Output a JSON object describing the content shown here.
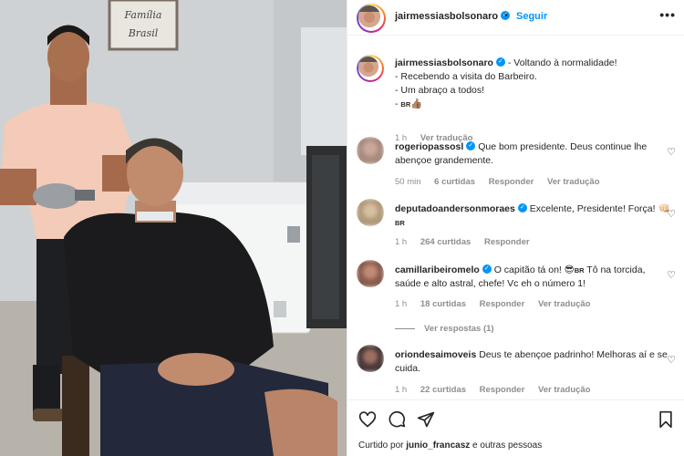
{
  "post_header": {
    "username": "jairmessiasbolsonaro",
    "dot": "•",
    "follow_label": "Seguir",
    "more_label": "•••"
  },
  "photo": {
    "frame_text_line1": "Família",
    "frame_text_line2": "Brasil"
  },
  "caption": {
    "username": "jairmessiasbolsonaro",
    "line1": "- Voltando à normalidade!",
    "line2": "- Recebendo a visita do Barbeiro.",
    "line3": "- Um abraço a todos!",
    "line4": "- ",
    "line4_flag": "BR",
    "line4_emoji": "👍🏽",
    "time": "1 h",
    "see_translation": "Ver tradução"
  },
  "comments": [
    {
      "username": "rogeriopassosl",
      "text_line1": "Que bom presidente. Deus continue lhe",
      "text_line2": "abençoe grandemente.",
      "time": "50 min",
      "likes": "6 curtidas",
      "reply": "Responder",
      "translate": "Ver tradução"
    },
    {
      "username": "deputadoandersonmoraes",
      "text_line1": "Excelente, Presidente! Força! 👊🏻",
      "text_line2": "BR",
      "time": "1 h",
      "likes": "264 curtidas",
      "reply": "Responder"
    },
    {
      "username": "camillaribeiromelo",
      "text_line1_a": "O capitão tá on! 😎",
      "text_line1_flag": "BR",
      "text_line1_b": " Tô na torcida,",
      "text_line2": "saúde e alto astral, chefe! Vc eh o número 1!",
      "time": "1 h",
      "likes": "18 curtidas",
      "reply": "Responder",
      "translate": "Ver tradução",
      "view_replies": "Ver respostas (1)"
    },
    {
      "username": "oriondesaimoveis",
      "text_line1": "Deus te abençoe padrinho! Melhoras aí e se",
      "text_line2": "cuida.",
      "time": "1 h",
      "likes": "22 curtidas",
      "reply": "Responder",
      "translate": "Ver tradução"
    }
  ],
  "actions": {
    "icons": [
      "heart-icon",
      "comment-icon",
      "share-icon",
      "bookmark-icon"
    ]
  },
  "liked_by": {
    "prefix": "Curtido por ",
    "user": "junio_francasz",
    "suffix": " e outras pessoas"
  },
  "colors": {
    "link_blue": "#0095f6",
    "text": "#262626",
    "muted": "#8e8e8e"
  }
}
